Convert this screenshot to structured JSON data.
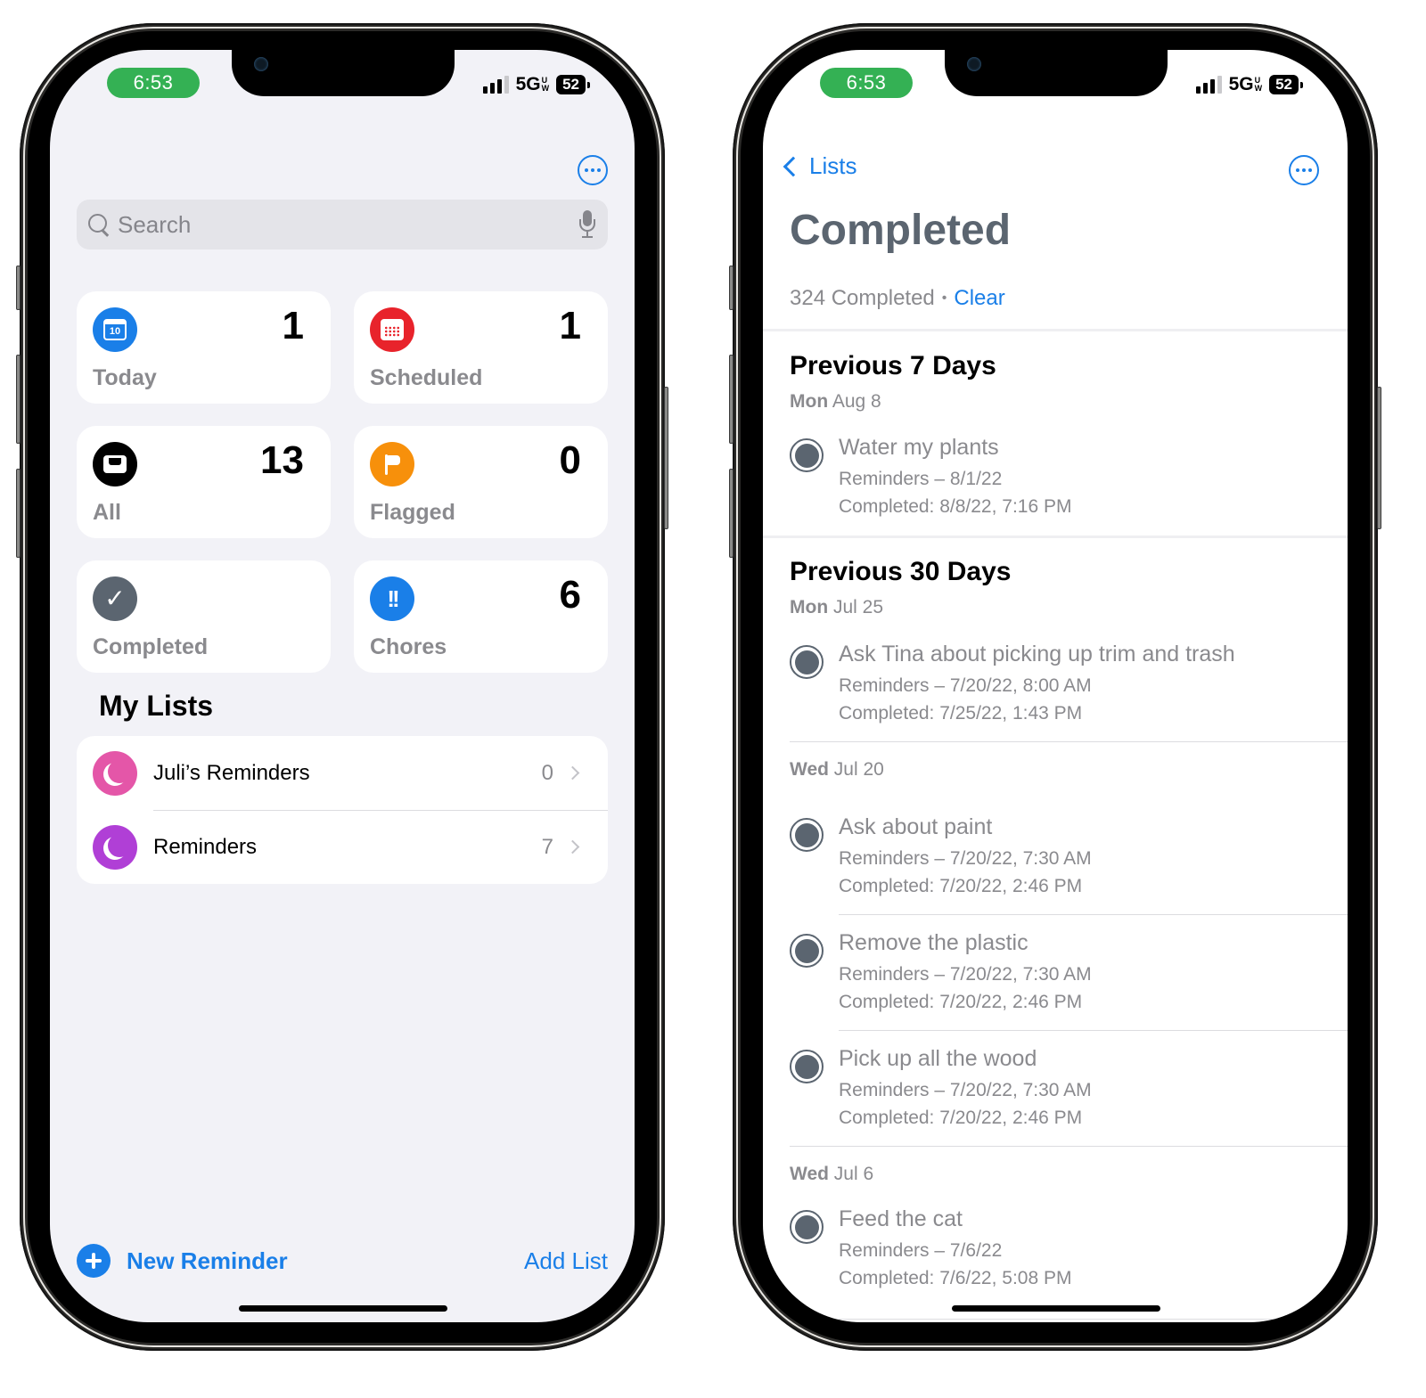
{
  "status_bar": {
    "time": "6:53",
    "network": "5G",
    "network_sup_top": "U",
    "network_sup_bottom": "W",
    "battery": "52"
  },
  "left_screen": {
    "search": {
      "placeholder": "Search",
      "value": ""
    },
    "smart_lists": [
      {
        "id": "today",
        "label": "Today",
        "count": "1",
        "icon": "calendar-today-icon",
        "icon_text": "10",
        "color": "#1a7fe8"
      },
      {
        "id": "scheduled",
        "label": "Scheduled",
        "count": "1",
        "icon": "calendar-grid-icon",
        "color": "#e8232b"
      },
      {
        "id": "all",
        "label": "All",
        "count": "13",
        "icon": "tray-icon",
        "color": "#000000"
      },
      {
        "id": "flagged",
        "label": "Flagged",
        "count": "0",
        "icon": "flag-icon",
        "color": "#f7900b"
      },
      {
        "id": "completed",
        "label": "Completed",
        "count": "",
        "icon": "checkmark-icon",
        "icon_text": "✓",
        "color": "#5b6570"
      },
      {
        "id": "chores",
        "label": "Chores",
        "count": "6",
        "icon": "exclamation-icon",
        "icon_text": "!!",
        "color": "#1a7fe8"
      }
    ],
    "my_lists_title": "My Lists",
    "my_lists": [
      {
        "name": "Juli’s Reminders",
        "count": "0",
        "color": "#e456a8",
        "icon": "moon-icon"
      },
      {
        "name": "Reminders",
        "count": "7",
        "color": "#b03fd6",
        "icon": "moon-icon"
      }
    ],
    "new_reminder_label": "New Reminder",
    "add_list_label": "Add List"
  },
  "right_screen": {
    "back_label": "Lists",
    "title": "Completed",
    "completed_count": "324 Completed",
    "separator": "•",
    "clear_label": "Clear",
    "sections": [
      {
        "heading": "Previous 7 Days",
        "groups": [
          {
            "day": "Mon",
            "date": "Aug 8",
            "items": [
              {
                "title": "Water my plants",
                "list_info": "Reminders – 8/1/22",
                "completed": "Completed: 8/8/22, 7:16 PM"
              }
            ]
          }
        ]
      },
      {
        "heading": "Previous 30 Days",
        "groups": [
          {
            "day": "Mon",
            "date": "Jul 25",
            "items": [
              {
                "title": "Ask Tina about picking up trim and trash",
                "list_info": "Reminders – 7/20/22, 8:00 AM",
                "completed": "Completed: 7/25/22, 1:43 PM"
              }
            ]
          },
          {
            "day": "Wed",
            "date": "Jul 20",
            "items": [
              {
                "title": "Ask about paint",
                "list_info": "Reminders – 7/20/22, 7:30 AM",
                "completed": "Completed: 7/20/22, 2:46 PM"
              },
              {
                "title": "Remove the plastic",
                "list_info": "Reminders – 7/20/22, 7:30 AM",
                "completed": "Completed: 7/20/22, 2:46 PM"
              },
              {
                "title": "Pick up all the wood",
                "list_info": "Reminders – 7/20/22, 7:30 AM",
                "completed": "Completed: 7/20/22, 2:46 PM"
              }
            ]
          },
          {
            "day": "Wed",
            "date": "Jul 6",
            "items": [
              {
                "title": "Feed the cat",
                "list_info": "Reminders – 7/6/22",
                "completed": "Completed: 7/6/22, 5:08 PM"
              }
            ]
          }
        ]
      }
    ]
  },
  "colors": {
    "accent": "#1a7fe8",
    "status_time_bg": "#34b154",
    "completed_gray": "#5b6570"
  }
}
